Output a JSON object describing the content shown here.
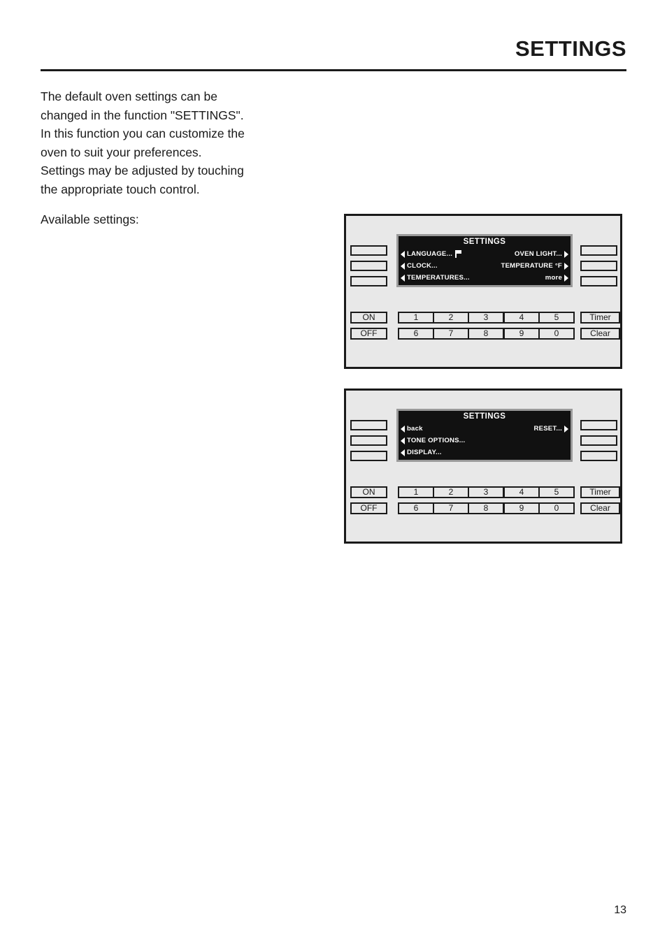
{
  "header": {
    "title": "SETTINGS"
  },
  "intro": {
    "paragraph_lines": [
      "The default oven settings can be",
      "changed in the function \"SETTINGS\".",
      "In this function you can customize the",
      "oven to suit your preferences.",
      "Settings may be adjusted by touching",
      "the appropriate touch control."
    ],
    "available_label": "Available settings:"
  },
  "panels": [
    {
      "lcd": {
        "title": "SETTINGS",
        "rows": [
          {
            "left_label": "LANGUAGE...",
            "left_icon": "flag-icon",
            "right_label": "OVEN LIGHT...",
            "right_arrow": true
          },
          {
            "left_label": "CLOCK...",
            "right_label": "TEMPERATURE °F",
            "right_arrow": true
          },
          {
            "left_label": "TEMPERATURES...",
            "right_label": "more",
            "right_arrow": true
          }
        ]
      },
      "keypad": {
        "on_label": "ON",
        "off_label": "OFF",
        "timer_label": "Timer",
        "clear_label": "Clear",
        "digits_row_1": [
          "1",
          "2",
          "3",
          "4",
          "5"
        ],
        "digits_row_2": [
          "6",
          "7",
          "8",
          "9",
          "0"
        ]
      }
    },
    {
      "lcd": {
        "title": "SETTINGS",
        "rows": [
          {
            "left_label": "back",
            "right_label": "RESET...",
            "right_arrow": true
          },
          {
            "left_label": "TONE OPTIONS...",
            "right_label": "",
            "right_arrow": false
          },
          {
            "left_label": "DISPLAY...",
            "right_label": "",
            "right_arrow": false
          }
        ]
      },
      "keypad": {
        "on_label": "ON",
        "off_label": "OFF",
        "timer_label": "Timer",
        "clear_label": "Clear",
        "digits_row_1": [
          "1",
          "2",
          "3",
          "4",
          "5"
        ],
        "digits_row_2": [
          "6",
          "7",
          "8",
          "9",
          "0"
        ]
      }
    }
  ],
  "footer": {
    "page_number": "13"
  },
  "colors": {
    "ink": "#1a1a1a",
    "panel_background": "#e8e8e8",
    "lcd_background": "#111111",
    "lcd_bezel": "#9a9a9a",
    "lcd_text": "#ffffff",
    "page_background": "#ffffff"
  }
}
